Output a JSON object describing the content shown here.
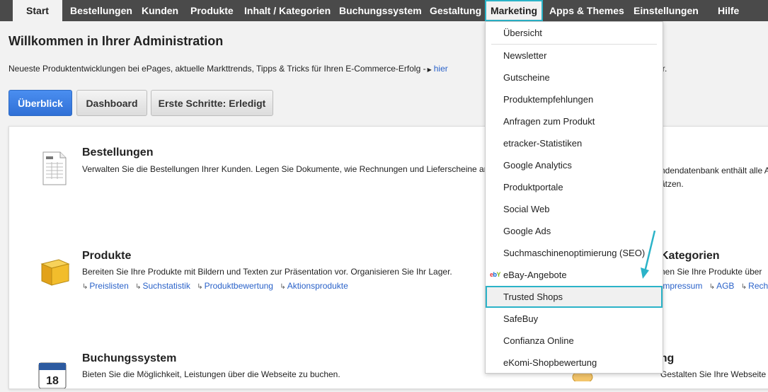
{
  "nav": {
    "items": [
      {
        "label": "Start"
      },
      {
        "label": "Bestellungen"
      },
      {
        "label": "Kunden"
      },
      {
        "label": "Produkte"
      },
      {
        "label": "Inhalt / Kategorien"
      },
      {
        "label": "Buchungssystem"
      },
      {
        "label": "Gestaltung"
      },
      {
        "label": "Marketing"
      },
      {
        "label": "Apps & Themes"
      },
      {
        "label": "Einstellungen"
      },
      {
        "label": "Hilfe"
      }
    ]
  },
  "page": {
    "title": "Willkommen in Ihrer Administration",
    "intro_text": "Neueste Produktentwicklungen bei ePages, aktuelle Markttrends, Tipps & Tricks für Ihren E-Commerce-Erfolg -",
    "intro_link": "hier",
    "intro_tail": "er."
  },
  "tabs": {
    "overview": "Überblick",
    "dashboard": "Dashboard",
    "first_steps": "Erste Schritte: Erledigt"
  },
  "sections": {
    "orders": {
      "title": "Bestellungen",
      "text": "Verwalten Sie die Bestellungen Ihrer Kunden. Legen Sie Dokumente, wie Rechnungen und Lieferscheine an."
    },
    "products": {
      "title": "Produkte",
      "text": "Bereiten Sie Ihre Produkte mit Bildern und Texten zur Präsentation vor. Organisieren Sie Ihr Lager.",
      "links": [
        "Preislisten",
        "Suchstatistik",
        "Produktbewertung",
        "Aktionsprodukte"
      ]
    },
    "booking": {
      "title": "Buchungssystem",
      "text": "Bieten Sie die Möglichkeit, Leistungen über die Webseite zu buchen.",
      "calendar_day": "18"
    },
    "customers_right": {
      "text_line1": "ndendatenbank enthält alle Ad",
      "text_line2": "ätzen."
    },
    "categories_right": {
      "title": "Kategorien",
      "text": "nen Sie Ihre Produkte über",
      "links": [
        "Impressum",
        "AGB",
        "Rech"
      ]
    },
    "design_right": {
      "title": "ung",
      "text": "Gestalten Sie Ihre Webseite über ein"
    }
  },
  "dropdown": {
    "items": [
      "Übersicht",
      "Newsletter",
      "Gutscheine",
      "Produktempfehlungen",
      "Anfragen zum Produkt",
      "etracker-Statistiken",
      "Google Analytics",
      "Produktportale",
      "Social Web",
      "Google Ads",
      "Suchmaschinenoptimierung (SEO)",
      "eBay-Angebote",
      "Trusted Shops",
      "SafeBuy",
      "Confianza Online",
      "eKomi-Shopbewertung"
    ],
    "ebay_logo": "ebY",
    "highlighted": "Trusted Shops"
  },
  "colors": {
    "nav_bg": "#4a4a4a",
    "highlight": "#2bb3c8",
    "primary_button": "#3a7fe0",
    "link": "#2a62c9"
  }
}
